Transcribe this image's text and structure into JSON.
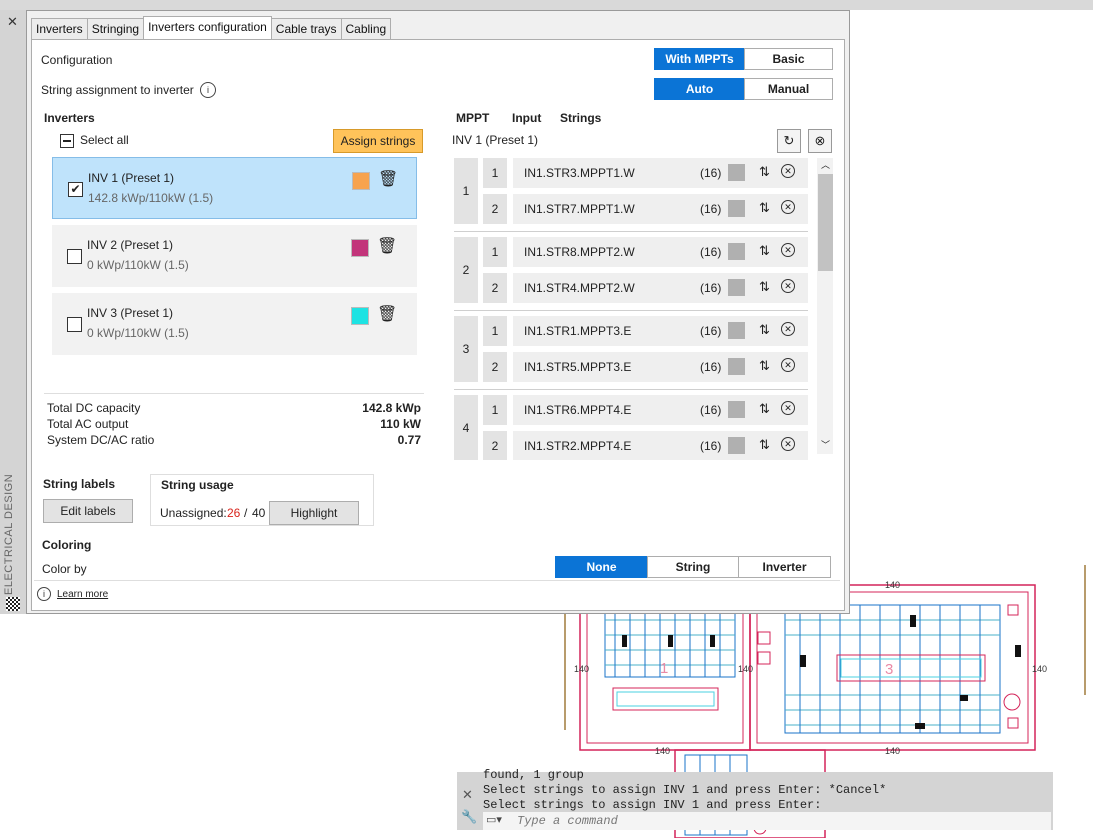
{
  "sidebar": {
    "vertical_title": "ELECTRICAL DESIGN"
  },
  "tabs": [
    "Inverters",
    "Stringing",
    "Inverters configuration",
    "Cable trays",
    "Cabling"
  ],
  "config": {
    "label": "Configuration",
    "assignment_label": "String assignment to inverter",
    "mode_options": [
      "With MPPTs",
      "Basic"
    ],
    "assign_options": [
      "Auto",
      "Manual"
    ]
  },
  "inverters": {
    "title": "Inverters",
    "select_all": "Select all",
    "assign_button": "Assign strings",
    "items": [
      {
        "name": "INV 1 (Preset 1)",
        "capacity": "142.8 kWp/110kW (1.5)",
        "checked": true,
        "color": "#f7a34e"
      },
      {
        "name": "INV 2 (Preset 1)",
        "capacity": "0 kWp/110kW (1.5)",
        "checked": false,
        "color": "#c2357a"
      },
      {
        "name": "INV 3 (Preset 1)",
        "capacity": "0 kWp/110kW (1.5)",
        "checked": false,
        "color": "#1ee3e3"
      }
    ],
    "totals": [
      {
        "label": "Total DC capacity",
        "value": "142.8 kWp"
      },
      {
        "label": "Total AC output",
        "value": "110 kW"
      },
      {
        "label": "System DC/AC ratio",
        "value": "0.77"
      }
    ]
  },
  "mppt_panel": {
    "headers": [
      "MPPT",
      "Input",
      "Strings"
    ],
    "inverter_label": "INV 1 (Preset 1)",
    "groups": [
      {
        "mppt": "1",
        "rows": [
          {
            "input": "1",
            "string": "IN1.STR3.MPPT1.W",
            "count": "(16)"
          },
          {
            "input": "2",
            "string": "IN1.STR7.MPPT1.W",
            "count": "(16)"
          }
        ]
      },
      {
        "mppt": "2",
        "rows": [
          {
            "input": "1",
            "string": "IN1.STR8.MPPT2.W",
            "count": "(16)"
          },
          {
            "input": "2",
            "string": "IN1.STR4.MPPT2.W",
            "count": "(16)"
          }
        ]
      },
      {
        "mppt": "3",
        "rows": [
          {
            "input": "1",
            "string": "IN1.STR1.MPPT3.E",
            "count": "(16)"
          },
          {
            "input": "2",
            "string": "IN1.STR5.MPPT3.E",
            "count": "(16)"
          }
        ]
      },
      {
        "mppt": "4",
        "rows": [
          {
            "input": "1",
            "string": "IN1.STR6.MPPT4.E",
            "count": "(16)"
          },
          {
            "input": "2",
            "string": "IN1.STR2.MPPT4.E",
            "count": "(16)"
          }
        ]
      }
    ]
  },
  "string_labels": {
    "title": "String labels",
    "button": "Edit labels"
  },
  "string_usage": {
    "title": "String usage",
    "label": "Unassigned:",
    "unassigned": "26",
    "separator": "/",
    "total": "40",
    "button": "Highlight",
    "accent": "#d9241c"
  },
  "coloring": {
    "title": "Coloring",
    "label": "Color by",
    "options": [
      "None",
      "String",
      "Inverter"
    ]
  },
  "learn_more": "Learn more",
  "cad": {
    "block_labels": [
      "1",
      "3"
    ],
    "dim_labels": [
      "140",
      "140",
      "140",
      "140",
      "140",
      "140"
    ]
  },
  "command": {
    "history": [
      "found, 1 group",
      "Select strings to assign INV 1 and press Enter: *Cancel*",
      "Select strings to assign INV 1 and press Enter:"
    ],
    "placeholder": "Type a command"
  }
}
